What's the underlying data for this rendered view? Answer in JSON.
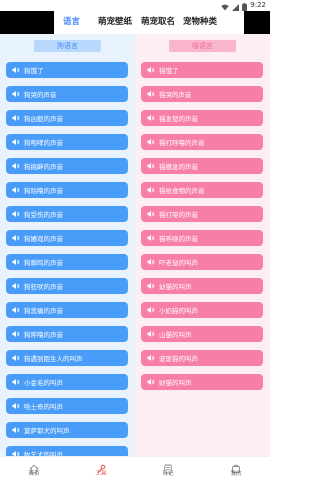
{
  "status_bar": {
    "time": "9:22"
  },
  "tabs": [
    {
      "label": "语言",
      "active": true
    },
    {
      "label": "萌宠壁纸",
      "active": false
    },
    {
      "label": "萌宠取名",
      "active": false
    },
    {
      "label": "宠物种类",
      "active": false
    }
  ],
  "dog_column": {
    "header": "狗语言",
    "items": [
      "狗饿了",
      "狗哭的声音",
      "狗凶狠的声音",
      "狗咆哮的声音",
      "狗挑衅的声音",
      "狗咕噜的声音",
      "狗受伤的声音",
      "狗嬉戏的声音",
      "狗嘶鸣的声音",
      "狗狂吠的声音",
      "狗悲痛的声音",
      "狗呼噜的声音",
      "狗遇到陌生人的叫声",
      "小金毛的叫声",
      "哈士奇的叫声",
      "莫萨耶犬的叫声",
      "牧羊犬的叫声"
    ]
  },
  "cat_column": {
    "header": "喵语言",
    "items": [
      "猫饿了",
      "猫哭的声音",
      "猫发怒的声音",
      "猫打呼噜的声音",
      "猫撒息的声音",
      "猫抢食物的声音",
      "猫打架的声音",
      "猫呼唤的声音",
      "吓老鼠的叫声",
      "幼猫的叫声",
      "小奶猫的叫声",
      "山猫的叫声",
      "波斯猫的叫声",
      "财猫的叫声"
    ]
  },
  "bottom_nav": [
    {
      "label": "首页",
      "icon": "home-icon",
      "active": false
    },
    {
      "label": "工具",
      "icon": "wrench-icon",
      "active": true
    },
    {
      "label": "日记",
      "icon": "diary-icon",
      "active": false
    },
    {
      "label": "我的",
      "icon": "profile-icon",
      "active": false
    }
  ],
  "colors": {
    "accent_blue": "#4a9cf9",
    "accent_pink": "#f77ea6",
    "active_tab": "#4a88f5",
    "active_nav": "#e15a5a"
  }
}
